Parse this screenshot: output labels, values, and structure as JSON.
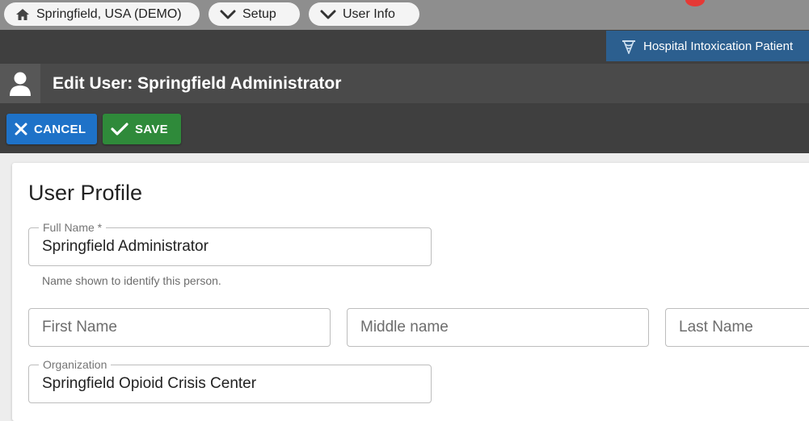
{
  "breadcrumbs": [
    {
      "label": "Springfield, USA (DEMO)",
      "icon": "home-icon"
    },
    {
      "label": "Setup",
      "icon": "chevron-down-icon"
    },
    {
      "label": "User Info",
      "icon": "chevron-down-icon"
    }
  ],
  "project": {
    "label": "Hospital Intoxication Patient",
    "icon": "caduceus-icon"
  },
  "header": {
    "title": "Edit User: Springfield Administrator",
    "icon": "user-icon"
  },
  "actions": {
    "cancel_label": "CANCEL",
    "save_label": "SAVE"
  },
  "profile": {
    "title": "User Profile",
    "full_name": {
      "label": "Full Name *",
      "value": "Springfield Administrator",
      "helper": "Name shown to identify this person."
    },
    "first_name": {
      "placeholder": "First Name",
      "value": ""
    },
    "middle_name": {
      "placeholder": "Middle name",
      "value": ""
    },
    "last_name": {
      "placeholder": "Last Name",
      "value": ""
    },
    "organization": {
      "label": "Organization",
      "value": "Springfield Opioid Crisis Center"
    }
  },
  "colors": {
    "cancel": "#1e72c8",
    "save": "#2f8a3a",
    "project_tag": "#2c5f8f",
    "header_bg": "#3f3f3f",
    "notification": "#e53935"
  }
}
